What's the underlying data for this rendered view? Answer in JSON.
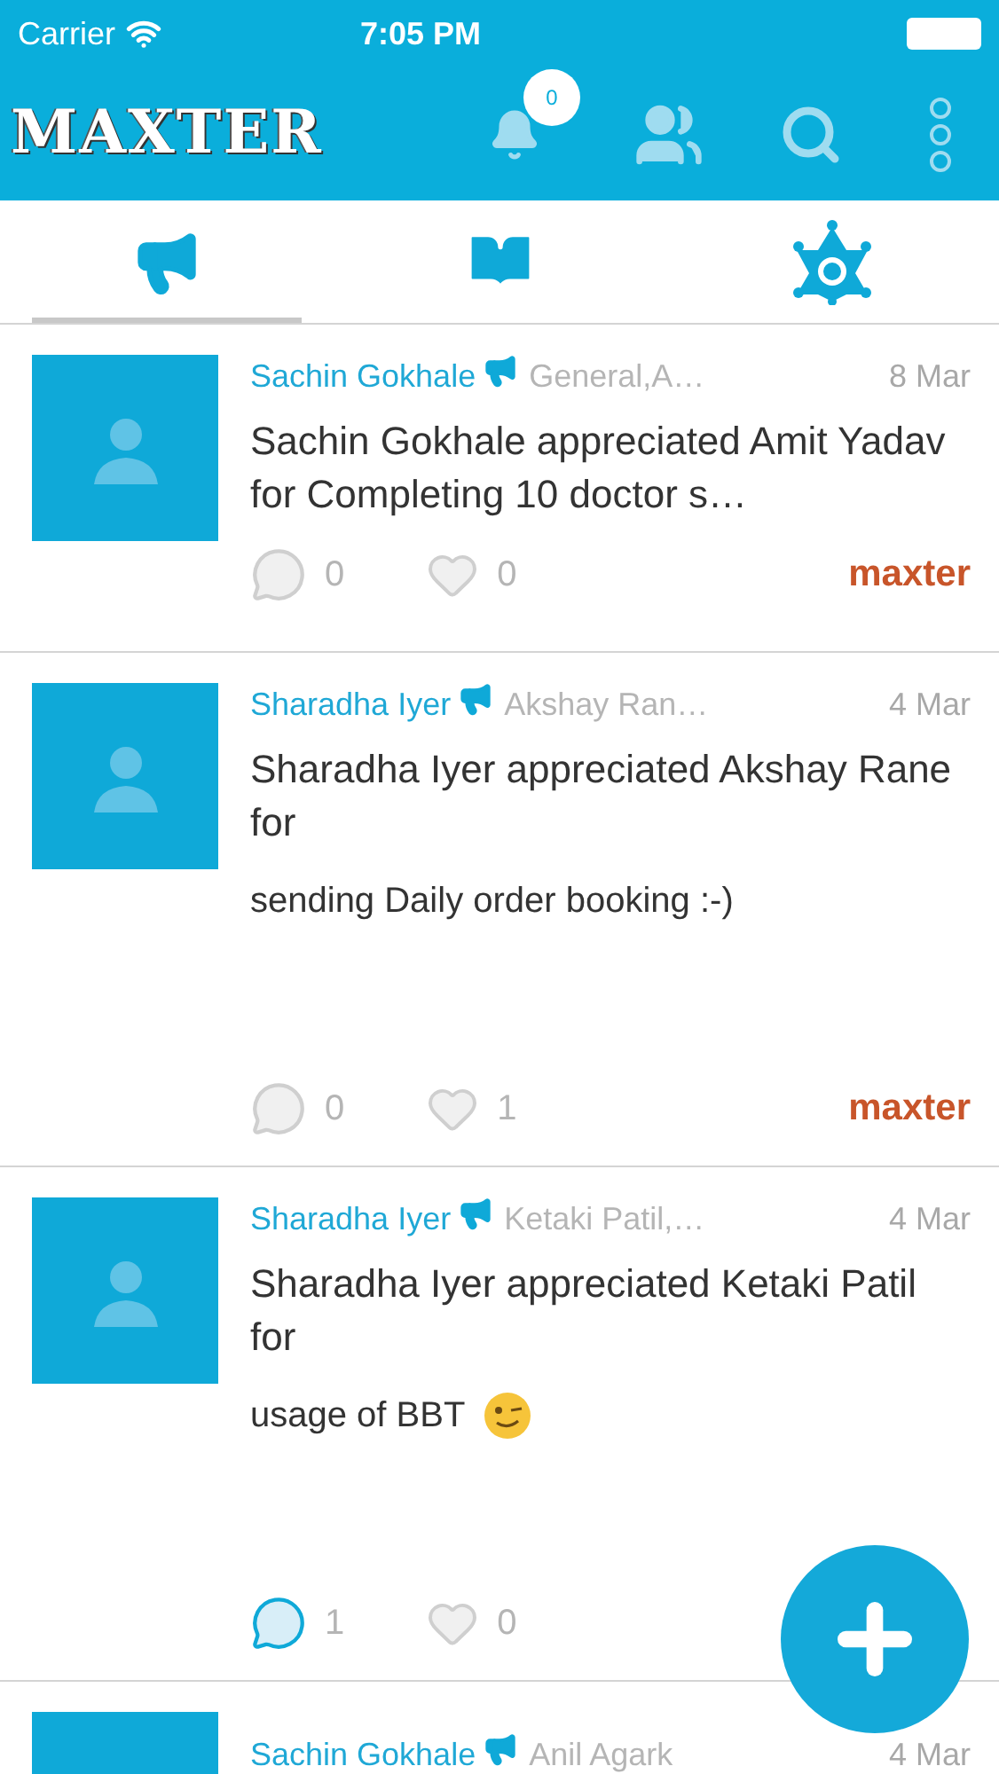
{
  "status_bar": {
    "carrier": "Carrier",
    "time": "7:05 PM"
  },
  "header": {
    "logo": "MAXTER",
    "notification_count": "0"
  },
  "tabs": [
    {
      "kind": "announce",
      "selected": true
    },
    {
      "kind": "book",
      "selected": false
    },
    {
      "kind": "badge",
      "selected": false
    }
  ],
  "posts": [
    {
      "author": "Sachin Gokhale",
      "recipients": "General,A…",
      "date": "8 Mar",
      "title": "Sachin Gokhale appreciated Amit Yadav for Completing 10 doctor s…",
      "comments": "0",
      "commented": false,
      "likes": "0",
      "liked": false,
      "brand": "maxter"
    },
    {
      "author": "Sharadha Iyer",
      "recipients": "Akshay Ran…",
      "date": "4 Mar",
      "title": "Sharadha Iyer appreciated Akshay Rane for",
      "message": "sending Daily order booking :-)",
      "comments": "0",
      "commented": false,
      "likes": "1",
      "liked": false,
      "brand": "maxter"
    },
    {
      "author": "Sharadha Iyer",
      "recipients": "Ketaki Patil,…",
      "date": "4 Mar",
      "title": "Sharadha Iyer appreciated Ketaki Patil for",
      "message": "usage of BBT",
      "wink_emoji": true,
      "comments": "1",
      "commented": true,
      "likes": "0",
      "liked": false
    },
    {
      "author": "Sachin Gokhale",
      "recipients": "Anil Agark",
      "date": "4 Mar",
      "partial": true
    }
  ]
}
